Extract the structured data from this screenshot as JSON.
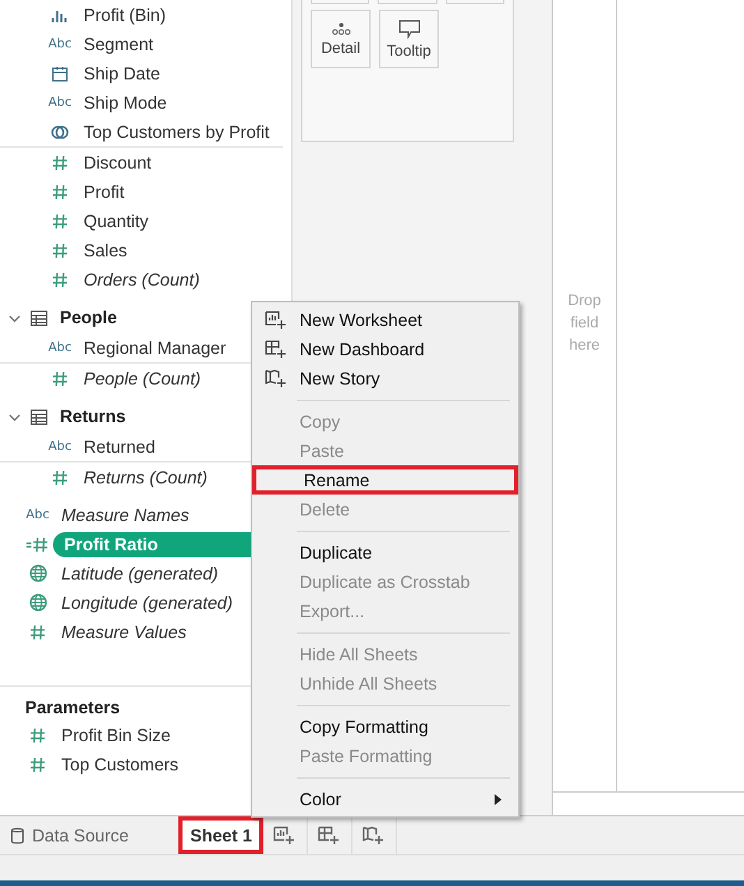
{
  "data_pane": {
    "fields": [
      {
        "label": "Profit (Bin)",
        "kind": "bin",
        "italic": false,
        "selected": false
      },
      {
        "label": "Segment",
        "kind": "text",
        "type_label": "Abc",
        "italic": false,
        "selected": false
      },
      {
        "label": "Ship Date",
        "kind": "date",
        "italic": false,
        "selected": false
      },
      {
        "label": "Ship Mode",
        "kind": "text",
        "type_label": "Abc",
        "italic": false,
        "selected": false
      },
      {
        "label": "Top Customers by Profit",
        "kind": "set",
        "italic": false,
        "selected": false,
        "divider": true
      },
      {
        "label": "Discount",
        "kind": "number",
        "italic": false,
        "selected": false
      },
      {
        "label": "Profit",
        "kind": "number",
        "italic": false,
        "selected": false
      },
      {
        "label": "Quantity",
        "kind": "number",
        "italic": false,
        "selected": false
      },
      {
        "label": "Sales",
        "kind": "number",
        "italic": false,
        "selected": false
      },
      {
        "label": "Orders (Count)",
        "kind": "number",
        "italic": true,
        "selected": false
      }
    ],
    "tables": [
      {
        "name": "People",
        "expanded": true,
        "fields": [
          {
            "label": "Regional Manager",
            "kind": "text",
            "type_label": "Abc",
            "italic": false,
            "selected": false,
            "divider": true
          },
          {
            "label": "People (Count)",
            "kind": "number",
            "italic": true,
            "selected": false
          }
        ]
      },
      {
        "name": "Returns",
        "expanded": true,
        "fields": [
          {
            "label": "Returned",
            "kind": "text",
            "type_label": "Abc",
            "italic": false,
            "selected": false,
            "divider": true
          },
          {
            "label": "Returns (Count)",
            "kind": "number",
            "italic": true,
            "selected": false
          }
        ]
      }
    ],
    "extra_fields": [
      {
        "label": "Measure Names",
        "kind": "text",
        "type_label": "Abc",
        "italic": true,
        "selected": false
      },
      {
        "label": "Profit Ratio",
        "kind": "calc",
        "italic": false,
        "selected": true
      },
      {
        "label": "Latitude (generated)",
        "kind": "geo",
        "italic": true,
        "selected": false
      },
      {
        "label": "Longitude (generated)",
        "kind": "geo",
        "italic": true,
        "selected": false
      },
      {
        "label": "Measure Values",
        "kind": "number",
        "italic": true,
        "selected": false
      }
    ],
    "parameters": {
      "title": "Parameters",
      "fields": [
        {
          "label": "Profit Bin Size",
          "kind": "number",
          "italic": false,
          "selected": false
        },
        {
          "label": "Top Customers",
          "kind": "number",
          "italic": false,
          "selected": false
        }
      ]
    }
  },
  "marks_card": {
    "buttons": [
      {
        "label": "Detail",
        "kind": "detail"
      },
      {
        "label": "Tooltip",
        "kind": "tooltip"
      }
    ]
  },
  "view": {
    "drop_hint": "Drop field here"
  },
  "tabs": [
    {
      "label": "Data Source",
      "kind": "datasource",
      "selected": false,
      "highlighted": false
    },
    {
      "label": "Sheet 1",
      "kind": "sheet",
      "selected": true,
      "highlighted": true
    }
  ],
  "context_menu": {
    "groups": [
      [
        {
          "label": "New Worksheet",
          "kind": "worksheet",
          "disabled": false,
          "highlighted": false,
          "submenu": false
        },
        {
          "label": "New Dashboard",
          "kind": "dashboard",
          "disabled": false,
          "highlighted": false,
          "submenu": false
        },
        {
          "label": "New Story",
          "kind": "story",
          "disabled": false,
          "highlighted": false,
          "submenu": false
        }
      ],
      [
        {
          "label": "Copy",
          "disabled": true,
          "highlighted": false,
          "submenu": false
        },
        {
          "label": "Paste",
          "disabled": true,
          "highlighted": false,
          "submenu": false
        },
        {
          "label": "Rename",
          "disabled": false,
          "highlighted": true,
          "submenu": false
        },
        {
          "label": "Delete",
          "disabled": true,
          "highlighted": false,
          "submenu": false
        }
      ],
      [
        {
          "label": "Duplicate",
          "disabled": false,
          "highlighted": false,
          "submenu": false
        },
        {
          "label": "Duplicate as Crosstab",
          "disabled": true,
          "highlighted": false,
          "submenu": false
        },
        {
          "label": "Export...",
          "disabled": true,
          "highlighted": false,
          "submenu": false
        }
      ],
      [
        {
          "label": "Hide All Sheets",
          "disabled": true,
          "highlighted": false,
          "submenu": false
        },
        {
          "label": "Unhide All Sheets",
          "disabled": true,
          "highlighted": false,
          "submenu": false
        }
      ],
      [
        {
          "label": "Copy Formatting",
          "disabled": false,
          "highlighted": false,
          "submenu": false
        },
        {
          "label": "Paste Formatting",
          "disabled": true,
          "highlighted": false,
          "submenu": false
        }
      ],
      [
        {
          "label": "Color",
          "disabled": false,
          "highlighted": false,
          "submenu": true
        }
      ]
    ]
  }
}
